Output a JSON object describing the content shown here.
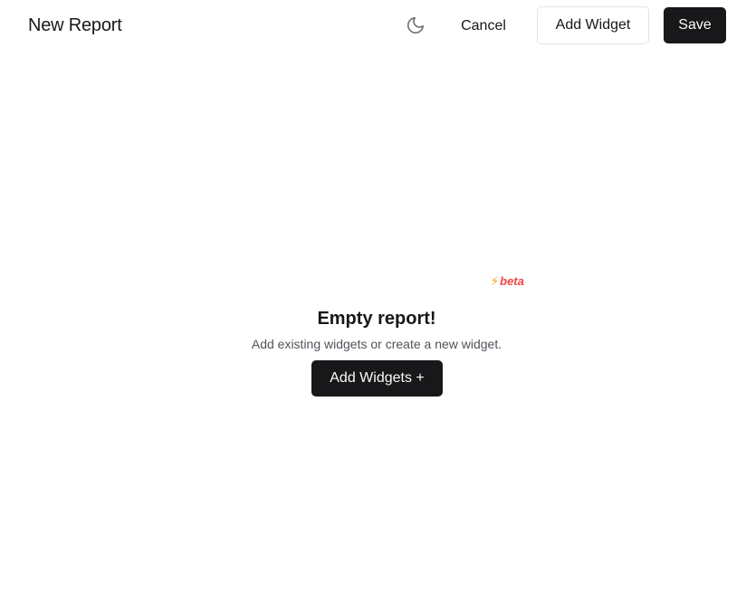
{
  "header": {
    "title": "New Report",
    "theme_toggle_icon": "moon-icon",
    "cancel_label": "Cancel",
    "add_widget_label": "Add Widget",
    "save_label": "Save"
  },
  "empty_state": {
    "badge_icon": "lightning-icon",
    "badge_label": "beta",
    "title": "Empty report!",
    "subtitle": "Add existing widgets or create a new widget.",
    "button_label": "Add Widgets +"
  },
  "colors": {
    "primary": "#18181b",
    "primary_text": "#fafafa",
    "border": "#e4e4e7",
    "muted_text": "#52525b",
    "beta_red": "#ef4444",
    "bolt_amber": "#f59e0b",
    "icon_gray": "#71717a"
  }
}
